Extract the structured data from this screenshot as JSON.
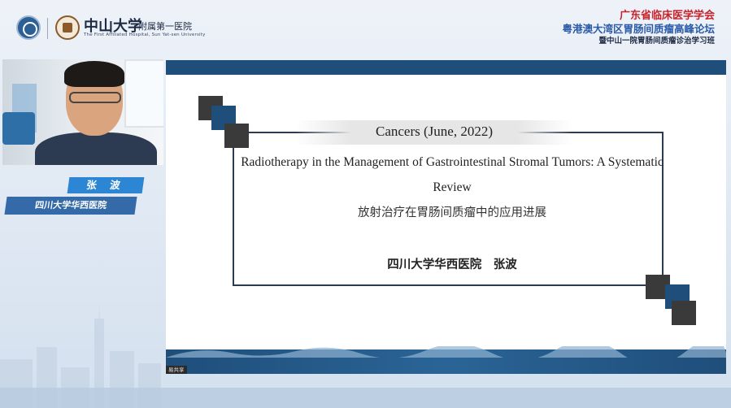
{
  "header": {
    "university_name": "中山大学",
    "hospital_name": "附属第一医院",
    "hospital_name_en": "The First Affiliated Hospital, Sun Yat-sen University",
    "logo_left_icon": "hospital-emblem-icon",
    "logo_right_icon": "university-seal-icon"
  },
  "organizer": {
    "line1": "广东省临床医学学会",
    "line2": "粤港澳大湾区胃肠间质瘤高峰论坛",
    "line3": "暨中山一院胃肠间质瘤诊治学习班",
    "line1_color": "#c8232c",
    "line2_color": "#2a5aa8"
  },
  "speaker": {
    "name": "张 波",
    "affiliation": "四川大学华西医院"
  },
  "slide": {
    "journal": "Cancers (June, 2022)",
    "title_en": "Radiotherapy in the Management of Gastrointestinal Stromal Tumors: A Systematic Review",
    "title_cn": "放射治疗在胃肠间质瘤中的应用进展",
    "author": "四川大学华西医院　张波",
    "footer_label": "易共享",
    "accent_color": "#1f4e7a"
  }
}
